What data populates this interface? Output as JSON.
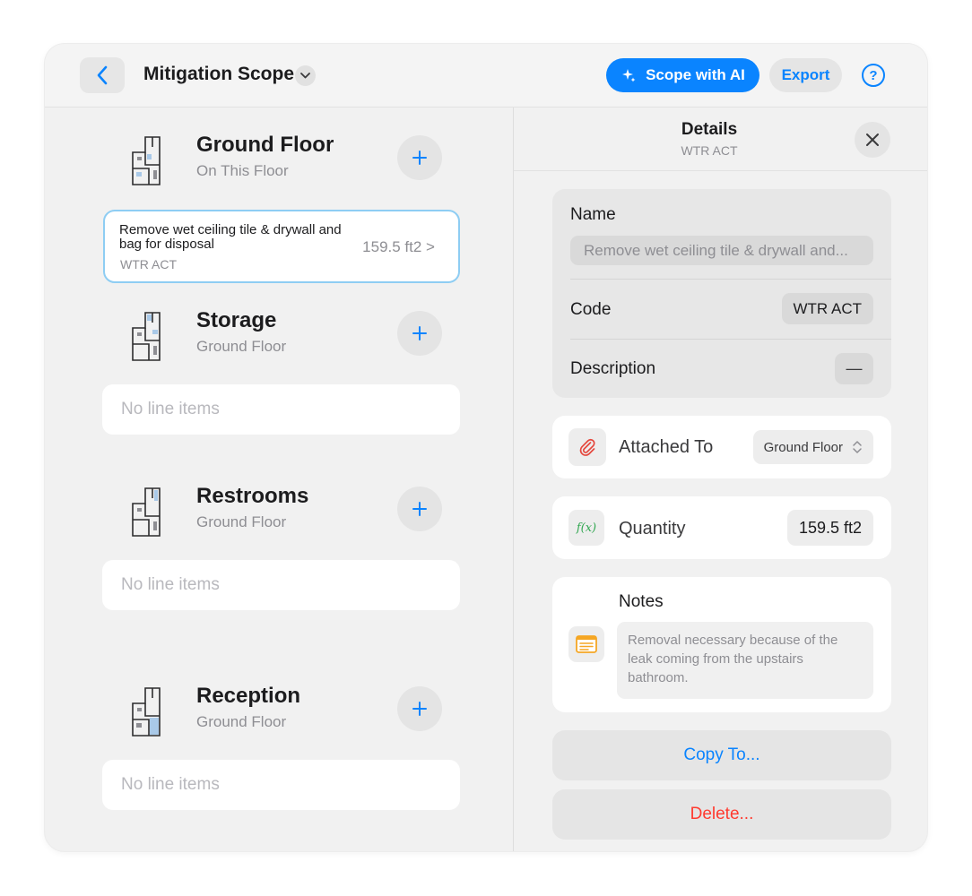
{
  "header": {
    "title": "Mitigation Scope",
    "ai_button_label": "Scope with AI",
    "export_label": "Export",
    "help_label": "?"
  },
  "rooms": [
    {
      "name": "Ground Floor",
      "subtitle": "On This Floor",
      "line_items": [
        {
          "name": "Remove wet ceiling tile & drywall and bag for disposal",
          "code": "WTR ACT",
          "quantity": "159.5 ft2 >"
        }
      ]
    },
    {
      "name": "Storage",
      "subtitle": "Ground Floor",
      "empty_label": "No line items"
    },
    {
      "name": "Restrooms",
      "subtitle": "Ground Floor",
      "empty_label": "No line items"
    },
    {
      "name": "Reception",
      "subtitle": "Ground Floor",
      "empty_label": "No line items"
    }
  ],
  "details": {
    "title": "Details",
    "subtitle": "WTR ACT",
    "name_label": "Name",
    "name_value": "Remove wet ceiling tile & drywall and...",
    "code_label": "Code",
    "code_value": "WTR ACT",
    "description_label": "Description",
    "description_value": "—",
    "attached_label": "Attached To",
    "attached_value": "Ground Floor",
    "quantity_label": "Quantity",
    "quantity_value": "159.5 ft2",
    "quantity_icon_text": "f(x)",
    "notes_label": "Notes",
    "notes_value": "Removal necessary because of the leak coming from the upstairs bathroom.",
    "copy_label": "Copy To...",
    "delete_label": "Delete..."
  },
  "colors": {
    "accent": "#0a84ff",
    "danger": "#ff3b30",
    "attach_icon": "#e5473d",
    "formula_icon": "#34a853",
    "notes_icon": "#f5a623"
  },
  "icons": [
    "chevron-left-icon",
    "chevron-down-icon",
    "sparkle-icon",
    "help-icon",
    "floorplan-icon",
    "plus-icon",
    "close-icon",
    "paperclip-icon",
    "function-icon",
    "notes-icon",
    "updown-chevron-icon"
  ]
}
